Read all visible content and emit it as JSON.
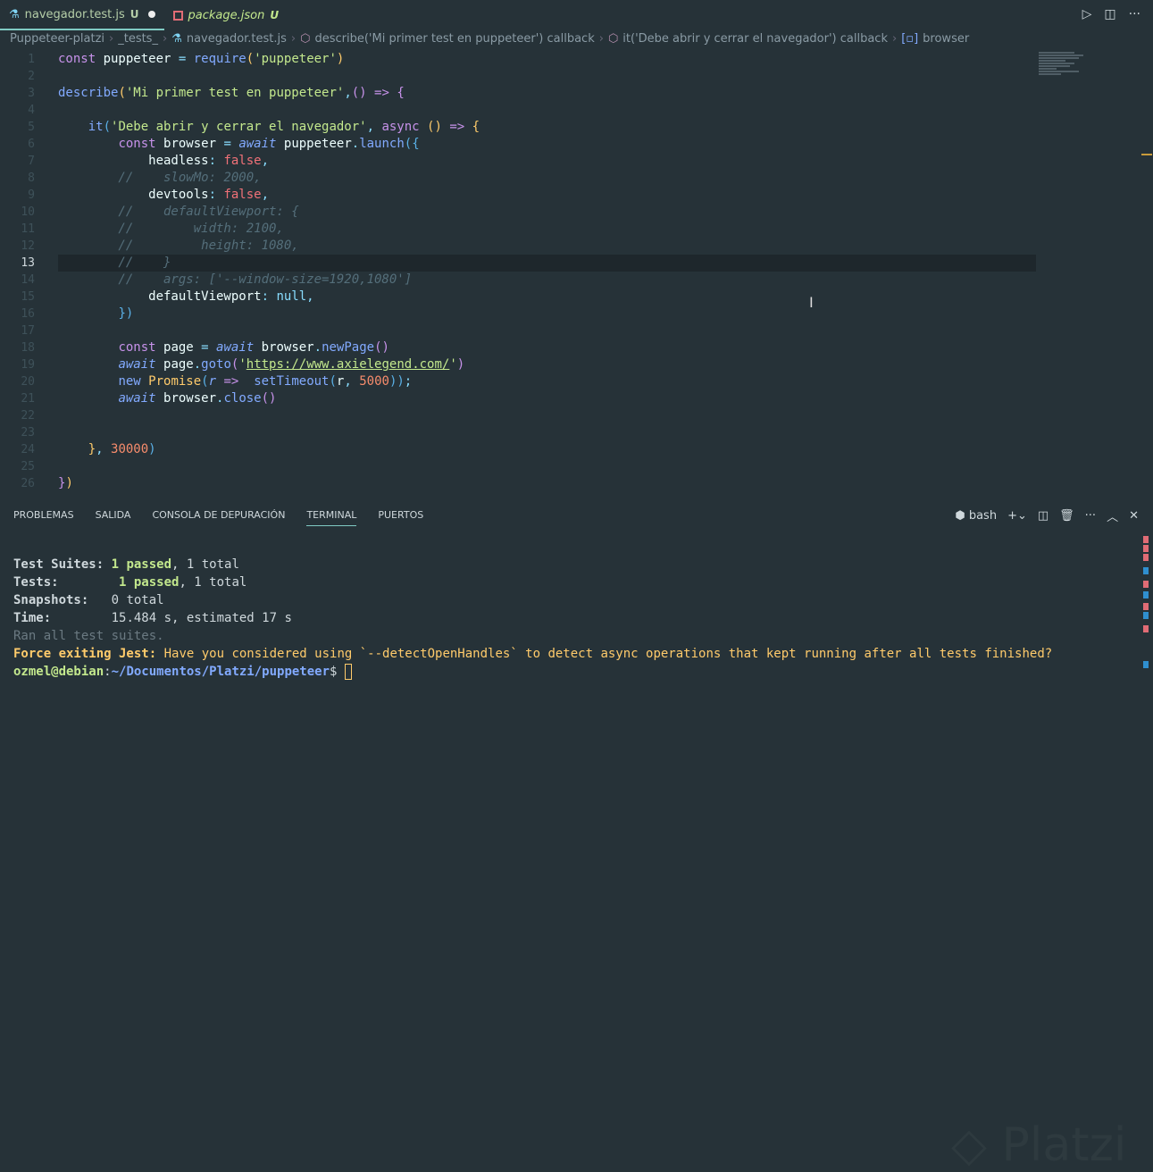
{
  "tabs": [
    {
      "label": "navegador.test.js",
      "status": "U",
      "modified": true,
      "active": true
    },
    {
      "label": "package.json",
      "status": "U",
      "active": false
    }
  ],
  "breadcrumb": [
    "Puppeteer-platzi",
    "_tests_",
    "navegador.test.js",
    "describe('Mi primer test en puppeteer') callback",
    "it('Debe abrir y cerrar el navegador') callback",
    "browser"
  ],
  "editor": {
    "current_line": 13,
    "lines": [
      [
        [
          "k",
          "const "
        ],
        [
          "p",
          "puppeteer "
        ],
        [
          "o",
          "= "
        ],
        [
          "f",
          "require"
        ],
        [
          "y",
          "("
        ],
        [
          "s",
          "'puppeteer'"
        ],
        [
          "y",
          ")"
        ]
      ],
      [],
      [
        [
          "f",
          "describe"
        ],
        [
          "y",
          "("
        ],
        [
          "s",
          "'Mi primer test en puppeteer'"
        ],
        [
          "o",
          ","
        ],
        [
          "pr",
          "() "
        ],
        [
          "k",
          "=> "
        ],
        [
          "pr",
          "{"
        ]
      ],
      [],
      [
        [
          "p",
          "    "
        ],
        [
          "f",
          "it"
        ],
        [
          "bl",
          "("
        ],
        [
          "s",
          "'Debe abrir y cerrar el navegador'"
        ],
        [
          "o",
          ", "
        ],
        [
          "k",
          "async "
        ],
        [
          "y",
          "() "
        ],
        [
          "k",
          "=> "
        ],
        [
          "y",
          "{"
        ]
      ],
      [
        [
          "p",
          "        "
        ],
        [
          "k",
          "const "
        ],
        [
          "p",
          "browser "
        ],
        [
          "o",
          "= "
        ],
        [
          "aw",
          "await "
        ],
        [
          "p",
          "puppeteer"
        ],
        [
          "o",
          "."
        ],
        [
          "f",
          "launch"
        ],
        [
          "bl",
          "({"
        ]
      ],
      [
        [
          "p",
          "            headless"
        ],
        [
          "o",
          ": "
        ],
        [
          "b",
          "false"
        ],
        [
          "o",
          ","
        ]
      ],
      [
        [
          "c",
          "        //    slowMo: 2000,"
        ]
      ],
      [
        [
          "p",
          "            devtools"
        ],
        [
          "o",
          ": "
        ],
        [
          "b",
          "false"
        ],
        [
          "o",
          ","
        ]
      ],
      [
        [
          "c",
          "        //    defaultViewport: {"
        ]
      ],
      [
        [
          "c",
          "        //        width: 2100,"
        ]
      ],
      [
        [
          "c",
          "        //         height: 1080,"
        ]
      ],
      [
        [
          "c",
          "        //    }"
        ]
      ],
      [
        [
          "c",
          "        //    args: ['--window-size=1920,1080']"
        ]
      ],
      [
        [
          "p",
          "            defaultViewport"
        ],
        [
          "o",
          ": "
        ],
        [
          "o",
          "null"
        ],
        [
          "o",
          ","
        ]
      ],
      [
        [
          "p",
          "        "
        ],
        [
          "bl",
          "})"
        ]
      ],
      [],
      [
        [
          "p",
          "        "
        ],
        [
          "k",
          "const "
        ],
        [
          "p",
          "page "
        ],
        [
          "o",
          "= "
        ],
        [
          "aw",
          "await "
        ],
        [
          "p",
          "browser"
        ],
        [
          "o",
          "."
        ],
        [
          "f",
          "newPage"
        ],
        [
          "pr",
          "()"
        ]
      ],
      [
        [
          "p",
          "        "
        ],
        [
          "aw",
          "await "
        ],
        [
          "p",
          "page"
        ],
        [
          "o",
          "."
        ],
        [
          "f",
          "goto"
        ],
        [
          "pr",
          "("
        ],
        [
          "s",
          "'"
        ],
        [
          "url",
          "https://www.axielegend.com/"
        ],
        [
          "s",
          "'"
        ],
        [
          "pr",
          ")"
        ]
      ],
      [
        [
          "p",
          "        "
        ],
        [
          "f",
          "new "
        ],
        [
          "y",
          "Promise"
        ],
        [
          "bl",
          "("
        ],
        [
          "aw",
          "r "
        ],
        [
          "k",
          "=>  "
        ],
        [
          "f",
          "setTimeout"
        ],
        [
          "bl",
          "("
        ],
        [
          "p",
          "r"
        ],
        [
          "o",
          ", "
        ],
        [
          "n",
          "5000"
        ],
        [
          "bl",
          "))"
        ],
        [
          "o",
          ";"
        ]
      ],
      [
        [
          "p",
          "        "
        ],
        [
          "aw",
          "await "
        ],
        [
          "p",
          "browser"
        ],
        [
          "o",
          "."
        ],
        [
          "f",
          "close"
        ],
        [
          "pr",
          "()"
        ]
      ],
      [],
      [],
      [
        [
          "p",
          "    "
        ],
        [
          "y",
          "}"
        ],
        [
          "o",
          ", "
        ],
        [
          "n",
          "30000"
        ],
        [
          "bl",
          ")"
        ]
      ],
      [],
      [
        [
          "pr",
          "}"
        ],
        [
          "y",
          ")"
        ]
      ]
    ]
  },
  "panel": {
    "tabs": [
      "PROBLEMAS",
      "SALIDA",
      "CONSOLA DE DEPURACIÓN",
      "TERMINAL",
      "PUERTOS"
    ],
    "active_tab": "TERMINAL",
    "shell": "bash"
  },
  "terminal": {
    "suites_label": "Test Suites:",
    "suites_passed": "1 passed",
    "suites_total": ", 1 total",
    "tests_label": "Tests:",
    "tests_passed": "1 passed",
    "tests_total": ", 1 total",
    "snap_label": "Snapshots:",
    "snap_value": "0 total",
    "time_label": "Time:",
    "time_value": "15.484 s, estimated 17 s",
    "ran": "Ran all test suites.",
    "force_label": "Force exiting Jest:",
    "force_msg": " Have you considered using `--detectOpenHandles` to detect async operations that kept running after all tests finished?",
    "user": "ozmel@debian",
    "path": "~/Documentos/Platzi/puppeteer",
    "prompt": "$ "
  },
  "watermark": "Platzi"
}
